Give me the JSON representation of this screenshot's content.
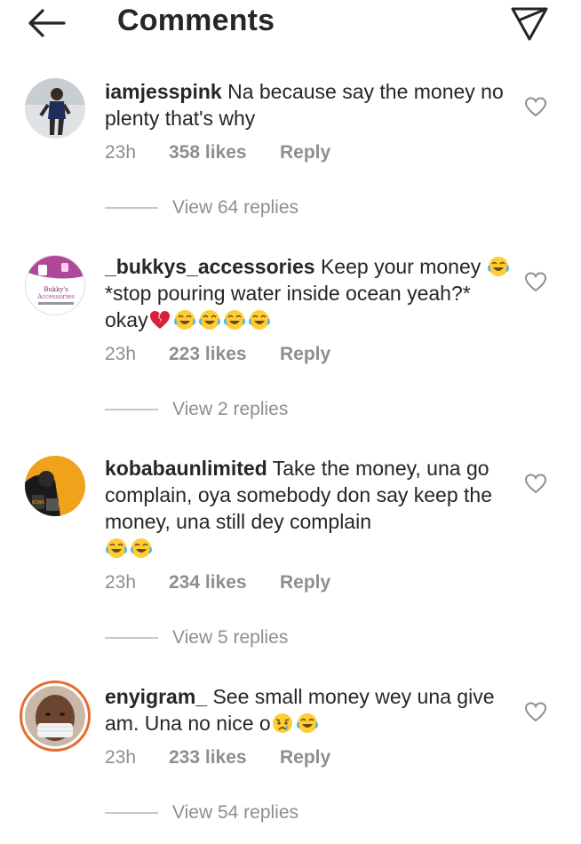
{
  "header": {
    "title": "Comments",
    "back_icon": "arrow-left-icon",
    "share_icon": "paper-plane-icon"
  },
  "comments": [
    {
      "username": "iamjesspink",
      "text": "Na because say the money no plenty that's why",
      "time": "23h",
      "likes": "358 likes",
      "reply": "Reply",
      "view_replies": "View 64 replies"
    },
    {
      "username": "_bukkys_accessories",
      "text_a": "Keep your money",
      "text_b": "*stop pouring water inside ocean yeah?* okay",
      "time": "23h",
      "likes": "223 likes",
      "reply": "Reply",
      "view_replies": "View 2 replies"
    },
    {
      "username": "kobabaunlimited",
      "text": "Take the money, una go complain, oya somebody don say keep the money, una still dey complain",
      "time": "23h",
      "likes": "234 likes",
      "reply": "Reply",
      "view_replies": "View 5 replies"
    },
    {
      "username": "enyigram_",
      "text": "See small money wey una give am. Una no nice o",
      "time": "23h",
      "likes": "233 likes",
      "reply": "Reply",
      "view_replies": "View 54 replies"
    }
  ],
  "colors": {
    "text": "#262626",
    "secondary": "#8e8e8e",
    "story_ring": "#e9692c"
  }
}
